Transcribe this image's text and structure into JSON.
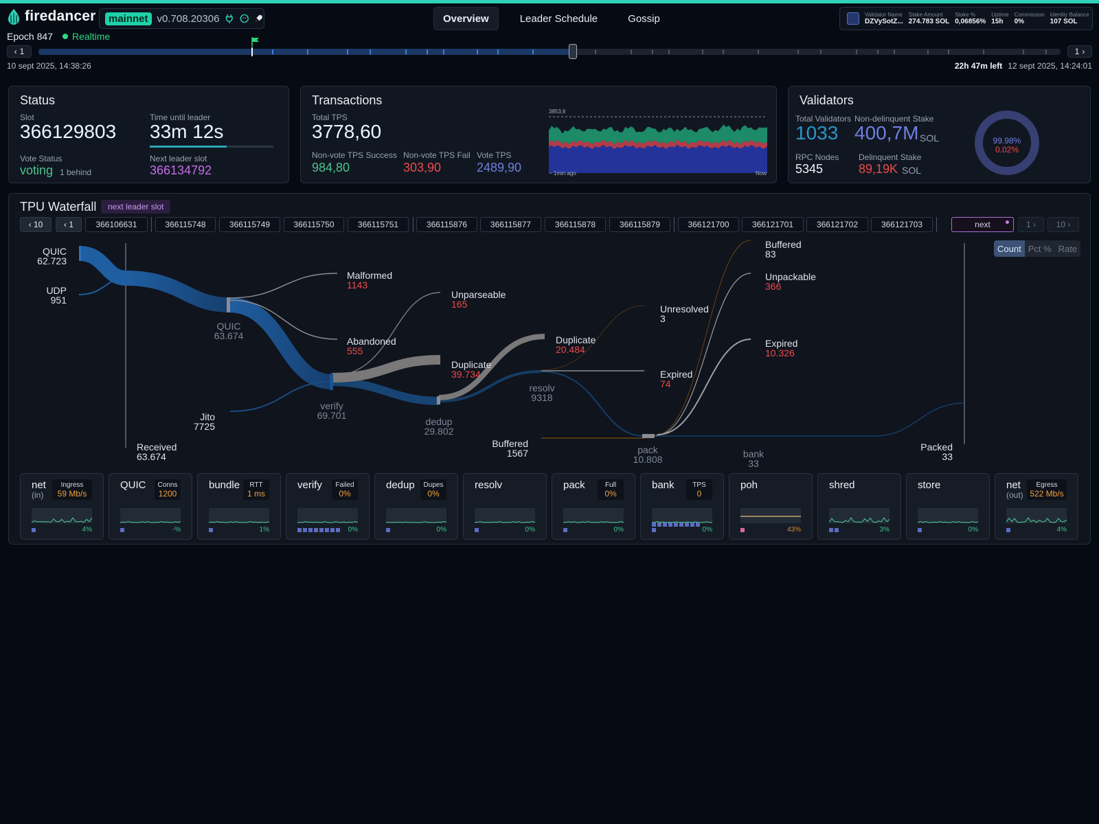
{
  "app": {
    "name": "firedancer",
    "network": "mainnet",
    "version": "v0.708.20306"
  },
  "nav": {
    "tabs": [
      "Overview",
      "Leader Schedule",
      "Gossip"
    ],
    "active": 0
  },
  "validator": {
    "fields": [
      {
        "k": "Validator Name",
        "v": "DZVySotZ..."
      },
      {
        "k": "Stake Amount",
        "v": "274.783 SOL"
      },
      {
        "k": "Stake %",
        "v": "0,06856%"
      },
      {
        "k": "Uptime",
        "v": "15h"
      },
      {
        "k": "Commission",
        "v": "0%"
      },
      {
        "k": "Identity Balance",
        "v": "107 SOL"
      }
    ]
  },
  "epoch": {
    "label": "Epoch 847",
    "mode": "Realtime",
    "prev_label": "1",
    "next_label": "1",
    "start": "10 sept 2025, 14:38:26",
    "time_left": "22h 47m left",
    "end": "12 sept 2025, 14:24:01",
    "progress": 0.52
  },
  "status": {
    "title": "Status",
    "slot_label": "Slot",
    "slot": "366129803",
    "time_label": "Time until leader",
    "time": "33m 12s",
    "time_progress": 0.62,
    "vote_label": "Vote Status",
    "vote": "voting",
    "vote_behind": "1 behind",
    "next_label": "Next leader slot",
    "next": "366134792"
  },
  "transactions": {
    "title": "Transactions",
    "total_label": "Total TPS",
    "total": "3778,60",
    "nv_success_label": "Non-vote TPS Success",
    "nv_success": "984,80",
    "nv_fail_label": "Non-vote TPS Fail",
    "nv_fail": "303,90",
    "vote_label": "Vote TPS",
    "vote": "2489,90",
    "chart_max": "3853,6",
    "chart_start": "~ 1min ago",
    "chart_end": "Now"
  },
  "validators": {
    "title": "Validators",
    "total_label": "Total Validators",
    "total": "1033",
    "nd_label": "Non-delinquent Stake",
    "nd": "400,7M",
    "unit": "SOL",
    "rpc_label": "RPC Nodes",
    "rpc": "5345",
    "delinquent_label": "Delinquent Stake",
    "delinquent": "89,19K",
    "donut_active": "99.98%",
    "donut_delinquent": "0.02%"
  },
  "waterfall": {
    "title": "TPU Waterfall",
    "badge": "next leader slot",
    "nav_left10": "10",
    "nav_left1": "1",
    "slots": [
      "366106631",
      "366115748",
      "366115749",
      "366115750",
      "366115751",
      "366115876",
      "366115877",
      "366115878",
      "366115879",
      "366121700",
      "366121701",
      "366121702",
      "366121703"
    ],
    "next_label": "next",
    "nav_right1": "1",
    "nav_right10": "10",
    "modes": [
      "Count",
      "Pct %",
      "Rate"
    ],
    "nodes": {
      "quic_in": {
        "name": "QUIC",
        "value": "62.723"
      },
      "udp": {
        "name": "UDP",
        "value": "951"
      },
      "received": {
        "name": "Received",
        "value": "63.674"
      },
      "quic": {
        "name": "QUIC",
        "value": "63.674"
      },
      "malformed": {
        "name": "Malformed",
        "value": "1143"
      },
      "abandoned": {
        "name": "Abandoned",
        "value": "555"
      },
      "unparseable": {
        "name": "Unparseable",
        "value": "165"
      },
      "jito": {
        "name": "Jito",
        "value": "7725"
      },
      "verify": {
        "name": "verify",
        "value": "69.701"
      },
      "dup_verify": {
        "name": "Duplicate",
        "value": "39.734"
      },
      "dedup": {
        "name": "dedup",
        "value": "29.802"
      },
      "dup_dedup": {
        "name": "Duplicate",
        "value": "20.484"
      },
      "resolv": {
        "name": "resolv",
        "value": "9318"
      },
      "unresolved": {
        "name": "Unresolved",
        "value": "3"
      },
      "expired_resolv": {
        "name": "Expired",
        "value": "74"
      },
      "buffered_in": {
        "name": "Buffered",
        "value": "1567"
      },
      "pack": {
        "name": "pack",
        "value": "10.808"
      },
      "buffered_out": {
        "name": "Buffered",
        "value": "83"
      },
      "unpackable": {
        "name": "Unpackable",
        "value": "366"
      },
      "expired_pack": {
        "name": "Expired",
        "value": "10.326"
      },
      "bank": {
        "name": "bank",
        "value": "33"
      },
      "packed": {
        "name": "Packed",
        "value": "33"
      }
    }
  },
  "tiles": [
    {
      "name": "net",
      "sub": "(in)",
      "badge_k": "Ingress",
      "badge_v": "59 Mb/s",
      "pct": "4%",
      "sq": 1
    },
    {
      "name": "QUIC",
      "sub": "",
      "badge_k": "Conns",
      "badge_v": "1200",
      "pct": "-%",
      "sq": 1
    },
    {
      "name": "bundle",
      "sub": "",
      "badge_k": "RTT",
      "badge_v": "1 ms",
      "pct": "1%",
      "sq": 1
    },
    {
      "name": "verify",
      "sub": "",
      "badge_k": "Failed",
      "badge_v": "0%",
      "pct": "0%",
      "sq": 8
    },
    {
      "name": "dedup",
      "sub": "",
      "badge_k": "Dupes",
      "badge_v": "0%",
      "pct": "0%",
      "sq": 1
    },
    {
      "name": "resolv",
      "sub": "",
      "badge_k": "",
      "badge_v": "",
      "pct": "0%",
      "sq": 1
    },
    {
      "name": "pack",
      "sub": "",
      "badge_k": "Full",
      "badge_v": "0%",
      "pct": "0%",
      "sq": 1
    },
    {
      "name": "bank",
      "sub": "",
      "badge_k": "TPS",
      "badge_v": "0",
      "pct": "0%",
      "sq": 10
    },
    {
      "name": "poh",
      "sub": "",
      "badge_k": "",
      "badge_v": "",
      "pct": "43%",
      "sq": 1
    },
    {
      "name": "shred",
      "sub": "",
      "badge_k": "",
      "badge_v": "",
      "pct": "3%",
      "sq": 2
    },
    {
      "name": "store",
      "sub": "",
      "badge_k": "",
      "badge_v": "",
      "pct": "0%",
      "sq": 1
    },
    {
      "name": "net",
      "sub": "(out)",
      "badge_k": "Egress",
      "badge_v": "522 Mb/s",
      "pct": "4%",
      "sq": 1
    }
  ],
  "colors": {
    "accent": "#2fd2b8",
    "vote_blue": "#6f7fe0",
    "fail_red": "#ef4a4a",
    "success_green": "#4cc38a",
    "next_purple": "#c76be8"
  }
}
